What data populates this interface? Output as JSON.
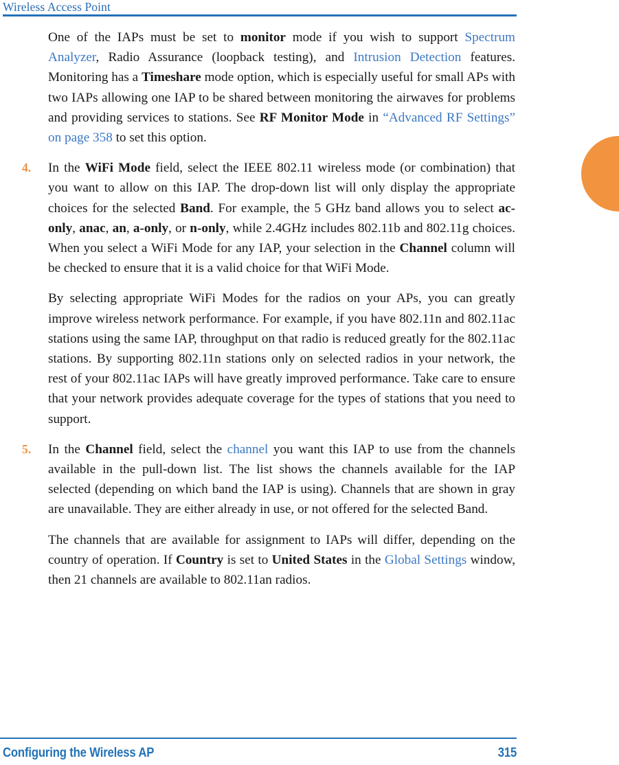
{
  "header": {
    "title": "Wireless Access Point",
    "rule_color": "#2272b8",
    "title_color": "#2a6db5"
  },
  "edge_tab": {
    "name": "chapter-thumb-tab",
    "color": "#f29340"
  },
  "colors": {
    "link": "#3b78c4",
    "list_number": "#ef8f3c",
    "body_text": "#1a1a1a",
    "footer": "#2272b8"
  },
  "body": {
    "intro_paragraph": {
      "seg1": "One of the IAPs must be set to ",
      "bold1": "monitor",
      "seg2": " mode if you wish to support ",
      "link1": "Spectrum Analyzer",
      "seg3": ", Radio Assurance (loopback testing), and ",
      "link2": "Intrusion Detection",
      "seg4": " features. Monitoring has a ",
      "bold2": "Timeshare",
      "seg5": " mode option, which is especially useful for small APs with two IAPs allowing one IAP to be shared between monitoring the airwaves for problems and providing services to stations. See ",
      "bold3": "RF Monitor Mode",
      "seg6": " in ",
      "link3": "“Advanced RF Settings” on page 358",
      "seg7": " to set this option."
    },
    "step4": {
      "number": "4.",
      "seg1": "In the ",
      "bold1": "WiFi Mode",
      "seg2": " field, select the IEEE 802.11 wireless mode (or combination) that you want to allow on this IAP. The drop-down list will only display the appropriate choices for the selected ",
      "bold2": "Band",
      "seg3": ". For example, the 5 GHz band allows you to select ",
      "bold3": "ac-only",
      "seg4": ", ",
      "bold4": "anac",
      "seg5": ", ",
      "bold5": "an",
      "seg6": ", ",
      "bold6": "a-only",
      "seg7": ", or ",
      "bold7": "n-only",
      "seg8": ", while 2.4GHz includes 802.11b and 802.11g choices. When you select a WiFi Mode for any IAP, your selection in the ",
      "bold8": "Channel",
      "seg9": " column will be checked to ensure that it is a valid choice for that WiFi Mode."
    },
    "wifi_modes_paragraph": "By selecting appropriate WiFi Modes for the radios on your APs, you can greatly improve wireless network performance. For example, if you have 802.11n and 802.11ac stations using the same IAP, throughput on that radio is reduced greatly for the 802.11ac stations. By supporting 802.11n stations only on selected radios in your network, the rest of your 802.11ac IAPs will have greatly improved performance. Take care to ensure that your network provides adequate coverage for the types of stations that you need to support.",
    "step5": {
      "number": "5.",
      "seg1": "In the ",
      "bold1": "Channel",
      "seg2": " field, select the ",
      "link1": "channel",
      "seg3": " you want this IAP to use from the channels available in the pull-down list. The list shows the channels available for the IAP selected (depending on which band the IAP is using). Channels that are shown in gray are unavailable. They are either already in use, or not offered for the selected Band."
    },
    "country_paragraph": {
      "seg1": "The channels that are available for assignment to IAPs will differ, depending on the country of operation. If ",
      "bold1": "Country",
      "seg2": " is set to ",
      "bold2": "United States",
      "seg3": " in the ",
      "link1": "Global Settings",
      "seg4": " window, then 21 channels are available to 802.11an radios."
    }
  },
  "footer": {
    "text": "Configuring the Wireless AP",
    "page": "315"
  }
}
